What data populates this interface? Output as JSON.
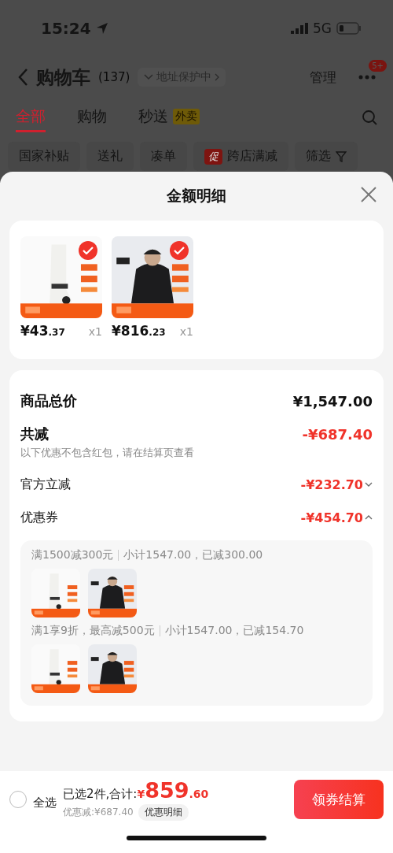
{
  "status_bar": {
    "time": "15:24",
    "network": "5G"
  },
  "nav": {
    "title": "购物车",
    "count": "(137)",
    "address": "地址保护中",
    "manage": "管理",
    "badge": "5+"
  },
  "tabs": [
    {
      "label": "全部",
      "selected": true
    },
    {
      "label": "购物",
      "selected": false
    },
    {
      "label": "秒送",
      "selected": false,
      "tag": "外卖"
    }
  ],
  "chips": [
    {
      "label": "国家补贴"
    },
    {
      "label": "送礼"
    },
    {
      "label": "凑单"
    },
    {
      "label": "跨店满减",
      "tag": "促"
    },
    {
      "label": "筛选",
      "kind": "filter"
    }
  ],
  "sheet": {
    "title": "金额明细",
    "products": [
      {
        "kind": "picture",
        "checked": true,
        "price": "¥43",
        "cents": ".37",
        "qty": "x1"
      },
      {
        "kind": "picture",
        "checked": true,
        "price": "¥816",
        "cents": ".23",
        "qty": "x1"
      }
    ],
    "total": {
      "label": "商品总价",
      "value": "¥1,547.00"
    },
    "reduced": {
      "label": "共减",
      "value": "-¥687.40",
      "note": "以下优惠不包含红包，请在结算页查看"
    },
    "breakdown": [
      {
        "label": "官方立减",
        "value": "-¥232.70",
        "expanded": false
      },
      {
        "label": "优惠券",
        "value": "-¥454.70",
        "expanded": true
      }
    ],
    "coupons": [
      {
        "rule": "满1500减300元",
        "detail": "小计1547.00，已减300.00"
      },
      {
        "rule": "满1享9折，最高减500元",
        "detail": "小计1547.00，已减154.70"
      }
    ]
  },
  "footer": {
    "select_all": {
      "label": "全选",
      "checked": false
    },
    "summary": "已选2件,合计:",
    "currency": "¥",
    "amount": "859",
    "cents": ".60",
    "discount": "优惠减:¥687.40",
    "detail_button": "优惠明细",
    "checkout": "领券结算"
  }
}
